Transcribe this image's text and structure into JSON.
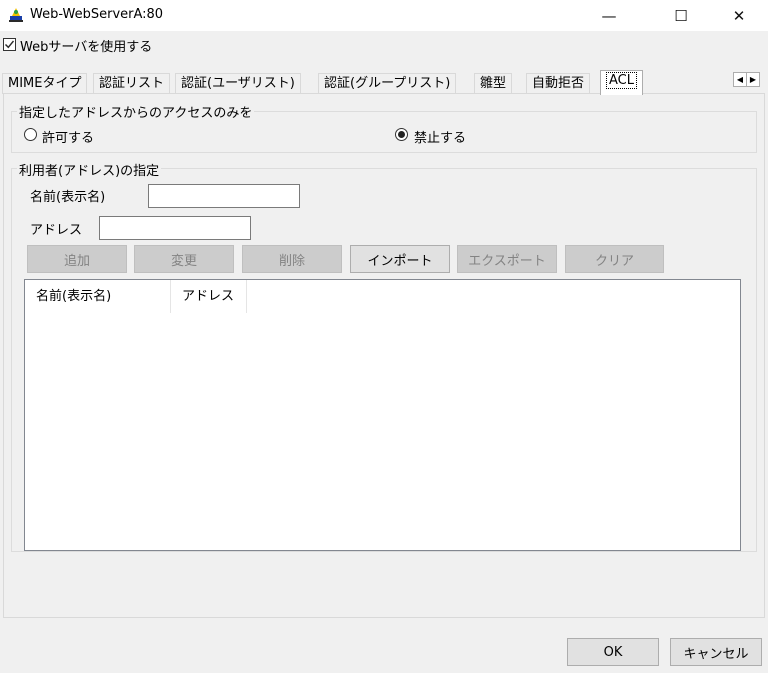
{
  "window": {
    "title": "Web-WebServerA:80",
    "minimize_glyph": "—",
    "maximize_glyph": "☐",
    "close_glyph": "✕"
  },
  "use_web_server": {
    "label": "Webサーバを使用する",
    "checked": true
  },
  "tabs": [
    {
      "label": "MIMEタイプ"
    },
    {
      "label": "認証リスト"
    },
    {
      "label": "認証(ユーザリスト)"
    },
    {
      "label": "認証(グループリスト)"
    },
    {
      "label": "雛型"
    },
    {
      "label": "自動拒否"
    },
    {
      "label": "ACL",
      "active": true
    }
  ],
  "access_group": {
    "title": "指定したアドレスからのアクセスのみを",
    "allow_label": "許可する",
    "deny_label": "禁止する",
    "selected": "deny"
  },
  "user_group": {
    "title": "利用者(アドレス)の指定",
    "name_label": "名前(表示名)",
    "name_value": "",
    "address_label": "アドレス",
    "address_value": ""
  },
  "buttons": {
    "add": "追加",
    "change": "変更",
    "delete": "削除",
    "import": "インポート",
    "export": "エクスポート",
    "clear": "クリア"
  },
  "list": {
    "columns": [
      "名前(表示名)",
      "アドレス"
    ],
    "rows": []
  },
  "footer": {
    "ok": "OK",
    "cancel": "キャンセル"
  },
  "colors": {
    "disabled_button": "#cccccc",
    "window_bg": "#f0f0f0",
    "checkmark": "#2b2b2b"
  }
}
